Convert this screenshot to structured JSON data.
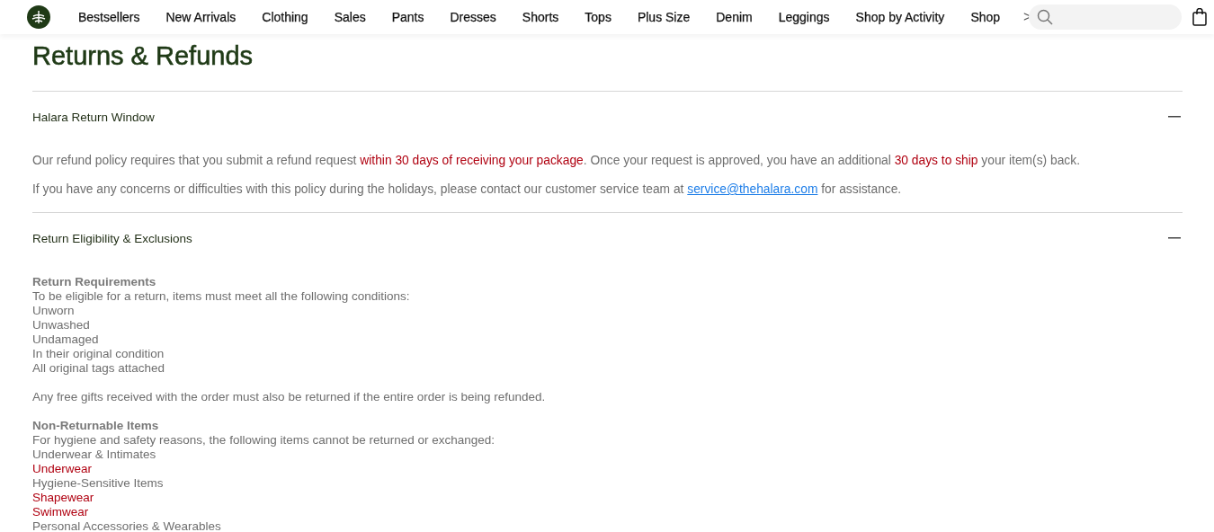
{
  "nav": {
    "items": [
      {
        "label": "Bestsellers"
      },
      {
        "label": "New Arrivals"
      },
      {
        "label": "Clothing"
      },
      {
        "label": "Sales"
      },
      {
        "label": "Pants"
      },
      {
        "label": "Dresses"
      },
      {
        "label": "Shorts"
      },
      {
        "label": "Tops"
      },
      {
        "label": "Plus Size"
      },
      {
        "label": "Denim"
      },
      {
        "label": "Leggings"
      },
      {
        "label": "Shop by Activity"
      },
      {
        "label": "Shop"
      }
    ],
    "more": ">"
  },
  "title": "Returns & Refunds",
  "sections": [
    {
      "title": "Halara Return Window",
      "expanded": true,
      "paragraphs": [
        [
          {
            "kind": "text",
            "text": "Our refund policy requires that you submit a refund request "
          },
          {
            "kind": "highlight",
            "text": "within 30 days of receiving your package"
          },
          {
            "kind": "text",
            "text": ". Once your request is approved, you have an additional "
          },
          {
            "kind": "highlight",
            "text": "30 days to ship"
          },
          {
            "kind": "text",
            "text": " your item(s) back."
          }
        ],
        [
          {
            "kind": "text",
            "text": "If you have any concerns or difficulties with this policy during the holidays, please contact our customer service team at "
          },
          {
            "kind": "link",
            "text": "service@thehalara.com"
          },
          {
            "kind": "text",
            "text": " for assistance."
          }
        ]
      ]
    },
    {
      "title": "Return Eligibility & Exclusions",
      "expanded": true,
      "lines": [
        {
          "kind": "heading",
          "text": "Return Requirements",
          "space_before": false
        },
        {
          "kind": "text",
          "text": "To be eligible for a return, items must meet all the following conditions:",
          "space_before": false
        },
        {
          "kind": "text",
          "text": "Unworn",
          "space_before": false
        },
        {
          "kind": "text",
          "text": "Unwashed",
          "space_before": false
        },
        {
          "kind": "text",
          "text": "Undamaged",
          "space_before": false
        },
        {
          "kind": "text",
          "text": "In their original condition",
          "space_before": false
        },
        {
          "kind": "text",
          "text": "All original tags attached",
          "space_before": false
        },
        {
          "kind": "text",
          "text": "Any free gifts received with the order must also be returned if the entire order is being refunded.",
          "space_before": true
        },
        {
          "kind": "heading",
          "text": "Non-Returnable Items",
          "space_before": true
        },
        {
          "kind": "text",
          "text": "For hygiene and safety reasons, the following items cannot be returned or exchanged:",
          "space_before": false
        },
        {
          "kind": "text",
          "text": "Underwear & Intimates",
          "space_before": false
        },
        {
          "kind": "highlight",
          "text": "Underwear",
          "space_before": false
        },
        {
          "kind": "text",
          "text": "Hygiene-Sensitive Items",
          "space_before": false
        },
        {
          "kind": "highlight",
          "text": "Shapewear",
          "space_before": false
        },
        {
          "kind": "highlight",
          "text": "Swimwear",
          "space_before": false
        },
        {
          "kind": "text",
          "text": "Personal Accessories & Wearables",
          "space_before": false
        }
      ]
    }
  ]
}
